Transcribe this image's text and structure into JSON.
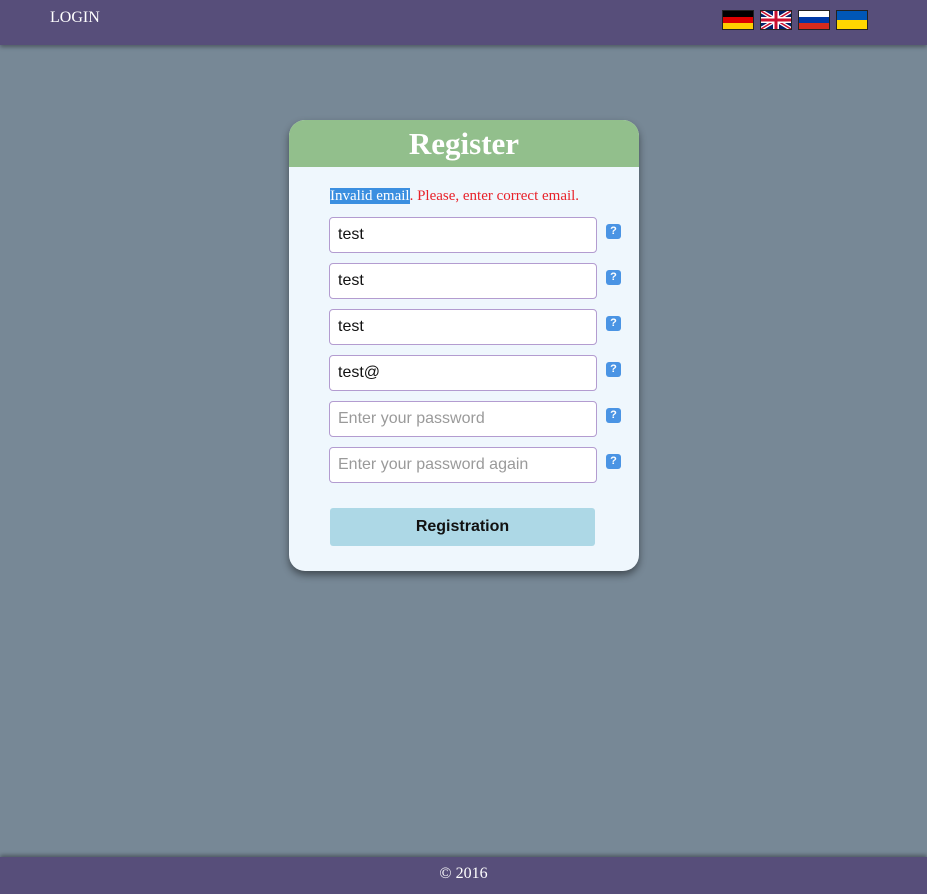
{
  "header": {
    "login_label": "LOGIN",
    "languages": [
      {
        "code": "de",
        "icon": "german-flag-icon"
      },
      {
        "code": "en",
        "icon": "uk-flag-icon"
      },
      {
        "code": "ru",
        "icon": "russian-flag-icon"
      },
      {
        "code": "ua",
        "icon": "ukrainian-flag-icon"
      }
    ]
  },
  "form": {
    "title": "Register",
    "error": {
      "highlighted": "Invalid email",
      "rest": ". Please, enter correct email."
    },
    "fields": [
      {
        "value": "test",
        "placeholder": ""
      },
      {
        "value": "test",
        "placeholder": ""
      },
      {
        "value": "test",
        "placeholder": ""
      },
      {
        "value": "test@",
        "placeholder": ""
      },
      {
        "value": "",
        "placeholder": "Enter your password"
      },
      {
        "value": "",
        "placeholder": "Enter your password again"
      }
    ],
    "help_symbol": "?",
    "submit_label": "Registration"
  },
  "footer": {
    "text": "© 2016"
  },
  "colors": {
    "topbar": "#574e7a",
    "background": "#778896",
    "card_header": "#92bf8c",
    "card_body": "#eff7fd",
    "error": "#e8222a",
    "button": "#add8e6",
    "help_icon": "#4a94e4"
  }
}
